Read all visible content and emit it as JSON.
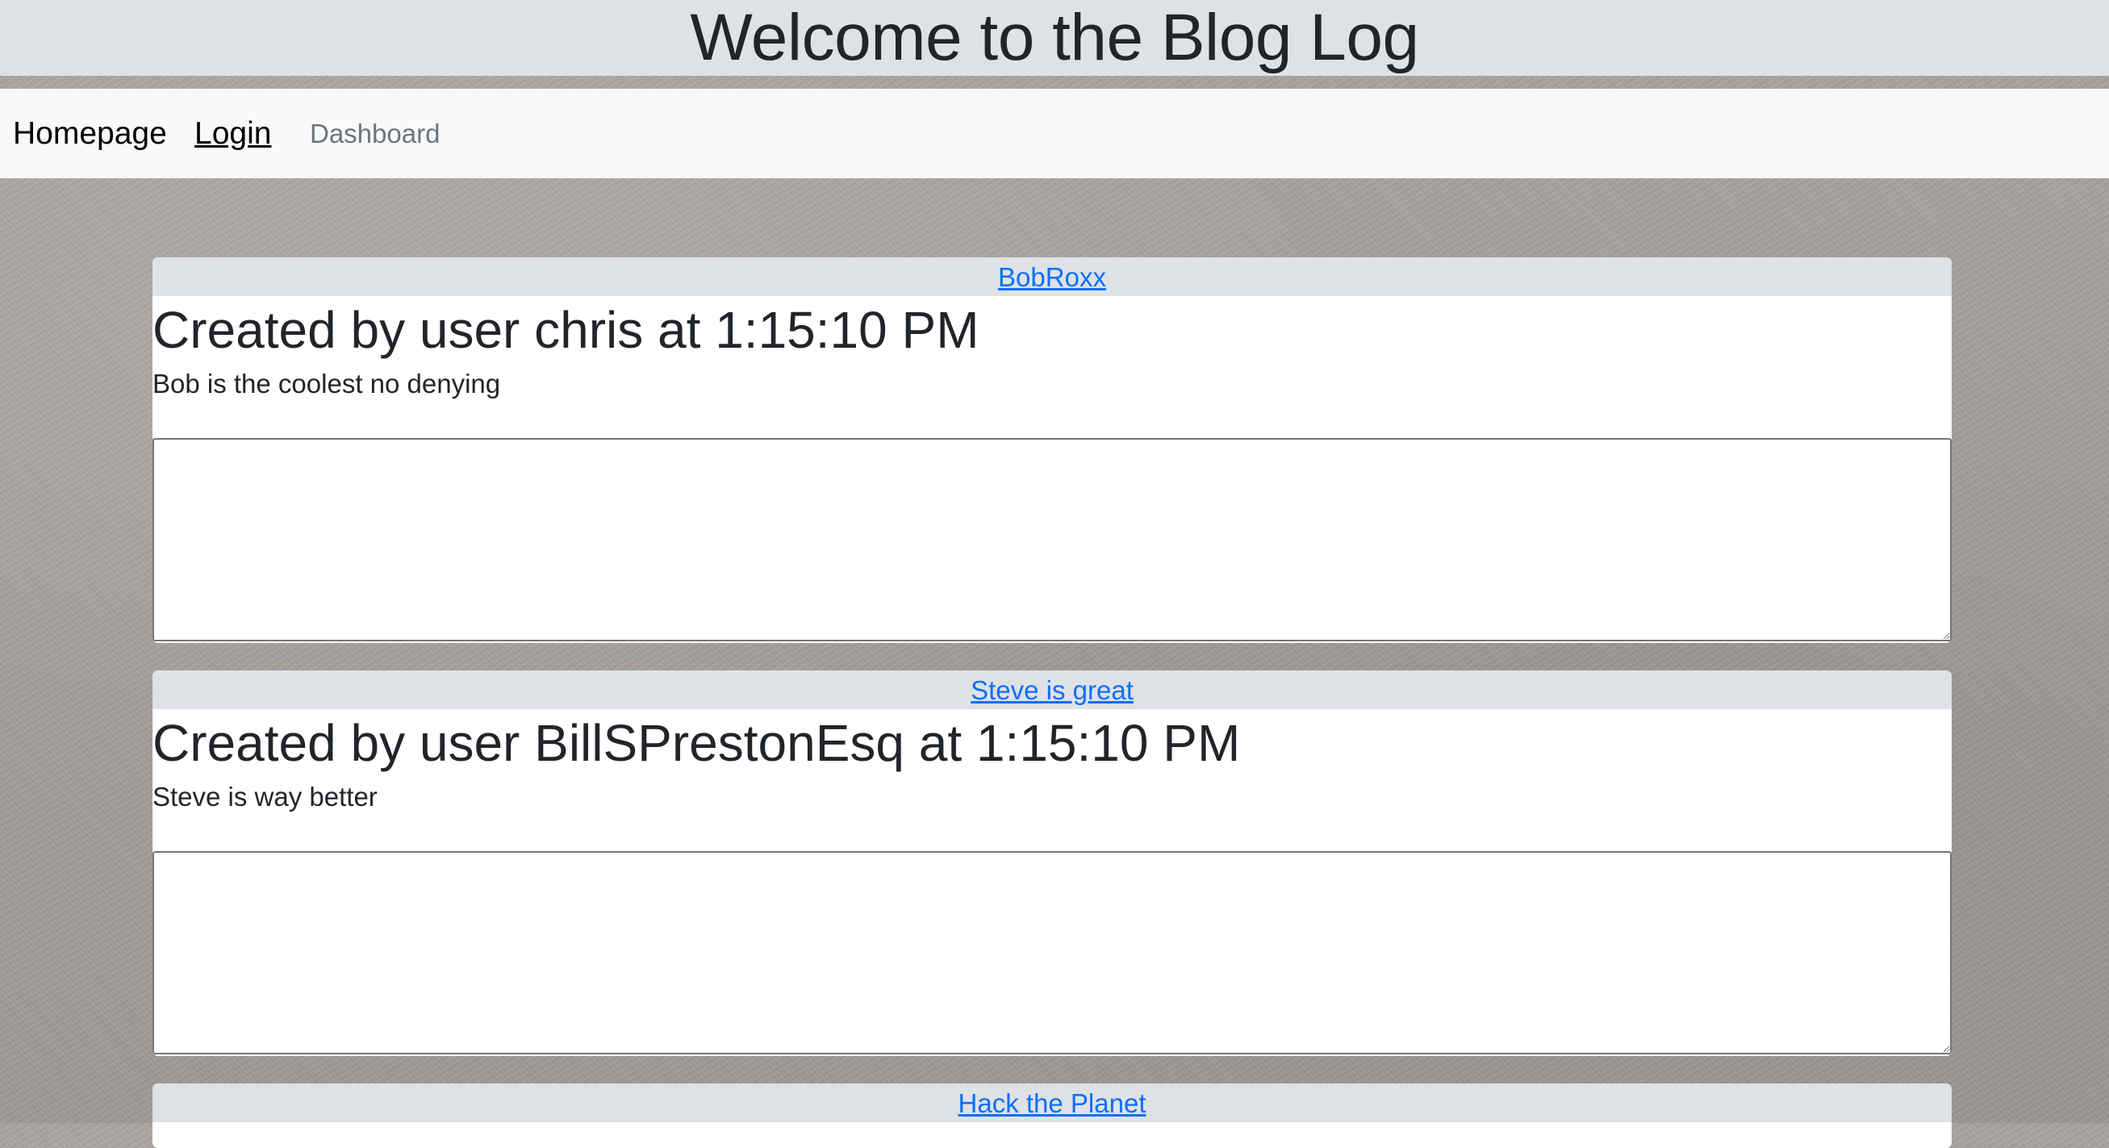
{
  "header": {
    "title": "Welcome to the Blog Log"
  },
  "nav": {
    "homepage": "Homepage",
    "login": "Login",
    "dashboard": "Dashboard"
  },
  "posts": [
    {
      "title": "BobRoxx",
      "meta": "Created by user chris at 1:15:10 PM",
      "content": "Bob is the coolest no denying",
      "comment_value": ""
    },
    {
      "title": "Steve is great",
      "meta": "Created by user BillSPrestonEsq at 1:15:10 PM",
      "content": "Steve is way better",
      "comment_value": ""
    },
    {
      "title": "Hack the Planet"
    }
  ]
}
